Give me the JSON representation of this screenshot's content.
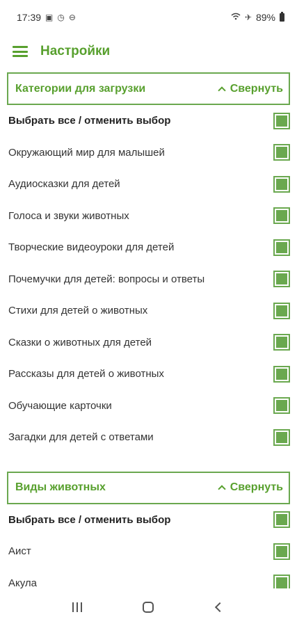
{
  "status_bar": {
    "time": "17:39",
    "battery": "89%",
    "icons_left": [
      "notification-icon",
      "clock-icon",
      "minus-circle-icon"
    ],
    "icons_right": [
      "wifi-icon",
      "airplane-icon",
      "battery-icon"
    ]
  },
  "app_bar": {
    "title": "Настройки",
    "menu_icon": "hamburger-menu-icon"
  },
  "colors": {
    "accent": "#58a02e",
    "border": "#6aa84f",
    "checkbox_fill": "#6aa84f"
  },
  "sections": [
    {
      "title": "Категории для загрузки",
      "collapse_label": "Свернуть",
      "select_all_label": "Выбрать все / отменить выбор",
      "items": [
        {
          "label": "Окружающий мир для малышей",
          "checked": true
        },
        {
          "label": "Аудиосказки для детей",
          "checked": true
        },
        {
          "label": "Голоса и звуки животных",
          "checked": true
        },
        {
          "label": "Творческие видеоуроки для детей",
          "checked": true
        },
        {
          "label": "Почемучки для детей: вопросы и ответы",
          "checked": true
        },
        {
          "label": "Стихи для детей о животных",
          "checked": true
        },
        {
          "label": "Сказки о животных для детей",
          "checked": true
        },
        {
          "label": "Рассказы для детей о животных",
          "checked": true
        },
        {
          "label": "Обучающие карточки",
          "checked": true
        },
        {
          "label": "Загадки для детей с ответами",
          "checked": true
        }
      ]
    },
    {
      "title": "Виды животных",
      "collapse_label": "Свернуть",
      "select_all_label": "Выбрать все / отменить выбор",
      "items": [
        {
          "label": "Аист",
          "checked": true
        },
        {
          "label": "Акула",
          "checked": true
        }
      ]
    }
  ],
  "nav_bar": {
    "buttons": [
      "recent-apps-icon",
      "home-icon",
      "back-icon"
    ]
  }
}
